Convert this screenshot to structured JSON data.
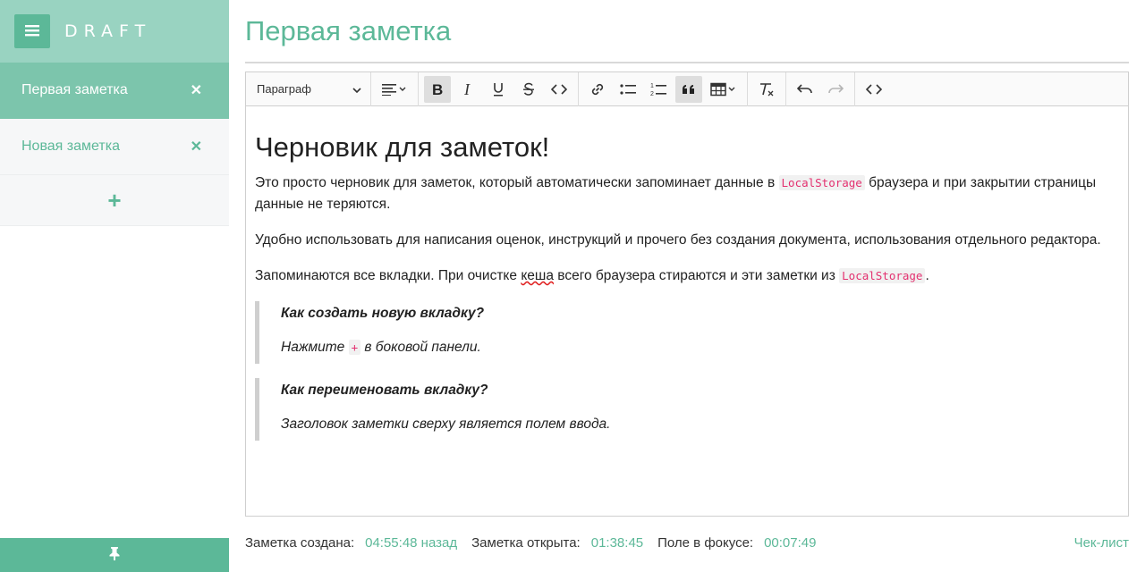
{
  "sidebar": {
    "brand": "DRAFT",
    "notes": [
      {
        "label": "Первая заметка",
        "active": true
      },
      {
        "label": "Новая заметка",
        "active": false
      }
    ],
    "add_symbol": "+",
    "close_symbol": "✕"
  },
  "note": {
    "title": "Первая заметка"
  },
  "toolbar": {
    "heading_select": "Параграф"
  },
  "content": {
    "heading": "Черновик для заметок!",
    "p1_before": "Это просто черновик для заметок, который автоматически запоминает данные в ",
    "p1_code": "LocalStorage",
    "p1_after": " браузера и при закрытии страницы данные не теряются.",
    "p2": "Удобно использовать для написания оценок, инструкций и прочего без создания документа, использования отдельного редактора.",
    "p3_before": "Запоминаются все вкладки. При очистке ",
    "p3_spell": "кеша",
    "p3_middle": " всего браузера стираются и эти заметки из ",
    "p3_code": "LocalStorage",
    "p3_after": ".",
    "quote1_q": "Как создать новую вкладку?",
    "quote1_before": "Нажмите ",
    "quote1_code": "+",
    "quote1_after": " в боковой панели.",
    "quote2_q": "Как переименовать вкладку?",
    "quote2_a": "Заголовок заметки сверху является полем ввода."
  },
  "status": {
    "created_label": "Заметка создана:",
    "created_value": "04:55:48 назад",
    "opened_label": "Заметка открыта:",
    "opened_value": "01:38:45",
    "focus_label": "Поле в фокусе:",
    "focus_value": "00:07:49",
    "checklist": "Чек-лист"
  },
  "colors": {
    "accent": "#5cb898",
    "header": "#99d3c1",
    "active_item": "#7cc5ac",
    "code_text": "#e3306f"
  }
}
